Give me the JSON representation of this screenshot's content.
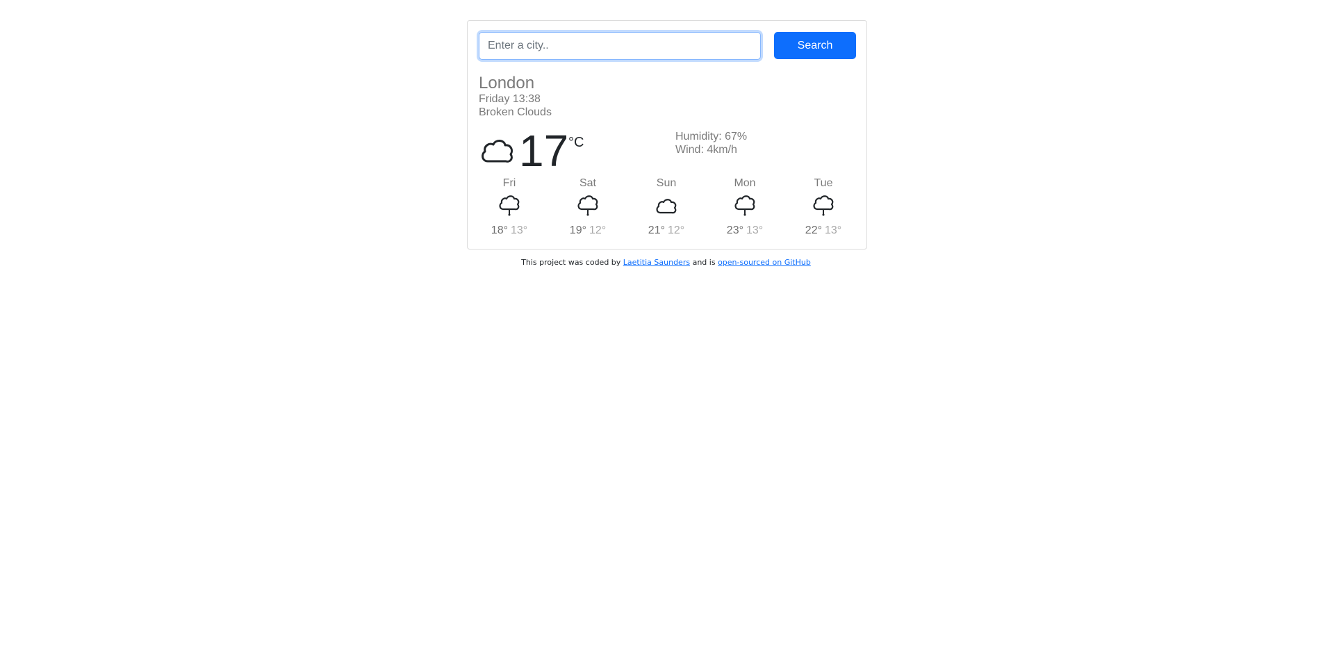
{
  "search": {
    "placeholder": "Enter a city..",
    "button_label": "Search"
  },
  "current": {
    "city": "London",
    "datetime": "Friday 13:38",
    "description": "Broken Clouds",
    "icon": "cloud-icon",
    "temperature": "17",
    "unit": "°C",
    "humidity": "Humidity: 67%",
    "wind": "Wind: 4km/h"
  },
  "forecast": [
    {
      "day": "Fri",
      "max": "18°",
      "min": "13°",
      "icon": "rain-cloud-icon"
    },
    {
      "day": "Sat",
      "max": "19°",
      "min": "12°",
      "icon": "rain-cloud-icon"
    },
    {
      "day": "Sun",
      "max": "21°",
      "min": "12°",
      "icon": "cloud-icon"
    },
    {
      "day": "Mon",
      "max": "23°",
      "min": "13°",
      "icon": "rain-cloud-icon"
    },
    {
      "day": "Tue",
      "max": "22°",
      "min": "13°",
      "icon": "rain-cloud-icon"
    }
  ],
  "footer": {
    "text_before": "This project was coded by",
    "author_link": "Laetitia Saunders",
    "text_middle": "and is",
    "github_link": "open-sourced on GitHub"
  },
  "colors": {
    "accent": "#0d6efd",
    "muted_text": "#7a7a7a",
    "dark_text": "#212529"
  }
}
